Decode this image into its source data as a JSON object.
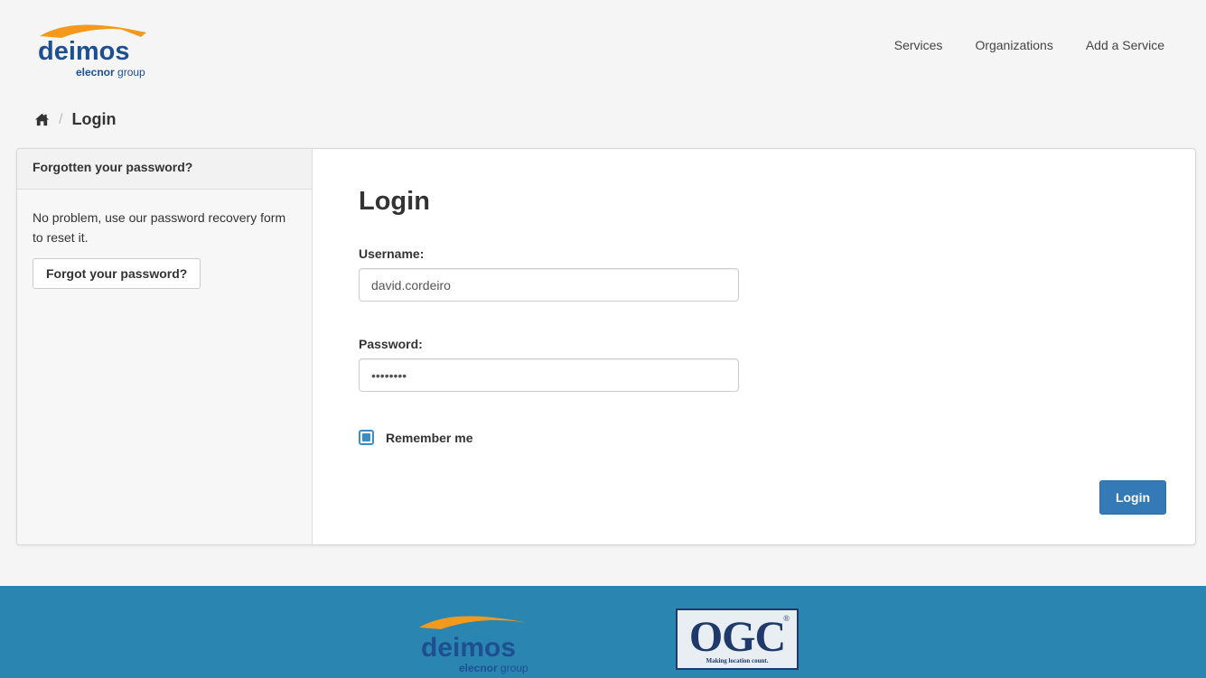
{
  "brand": {
    "logo_name": "deimos",
    "logo_sub_bold": "elecnor",
    "logo_sub": " group",
    "accent_orange": "#f39a1d",
    "logo_blue": "#1d4f91"
  },
  "nav": {
    "items": [
      {
        "label": "Services"
      },
      {
        "label": "Organizations"
      },
      {
        "label": "Add a Service"
      }
    ]
  },
  "breadcrumb": {
    "separator": "/",
    "current": "Login"
  },
  "sidebar": {
    "title": "Forgotten your password?",
    "text": "No problem, use our password recovery form to reset it.",
    "button_label": "Forgot your password?"
  },
  "form": {
    "heading": "Login",
    "username_label": "Username:",
    "username_value": "david.cordeiro",
    "password_label": "Password:",
    "password_value": "••••••••",
    "remember_label": "Remember me",
    "remember_checked": true,
    "submit_label": "Login",
    "primary_color": "#337ab7"
  },
  "footer": {
    "background": "#2a86b0",
    "ogc_text": "OGC",
    "ogc_reg": "®",
    "ogc_tagline": "Making location count."
  }
}
